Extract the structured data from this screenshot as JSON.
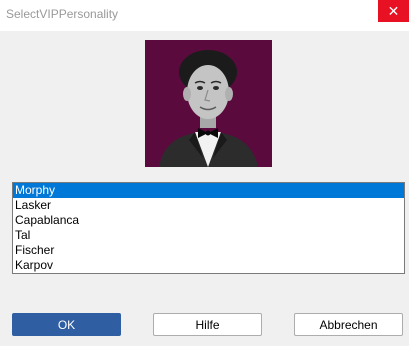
{
  "window": {
    "title": "SelectVIPPersonality",
    "close_label": "✕"
  },
  "list": {
    "items": [
      "Morphy",
      "Lasker",
      "Capablanca",
      "Tal",
      "Fischer",
      "Karpov"
    ],
    "selected_index": 0
  },
  "buttons": {
    "ok": "OK",
    "help": "Hilfe",
    "cancel": "Abbrechen"
  },
  "colors": {
    "portrait_background": "#5b0a3e",
    "selection": "#0078d7",
    "primary_button": "#2f5ea3",
    "close_button": "#e81123"
  }
}
